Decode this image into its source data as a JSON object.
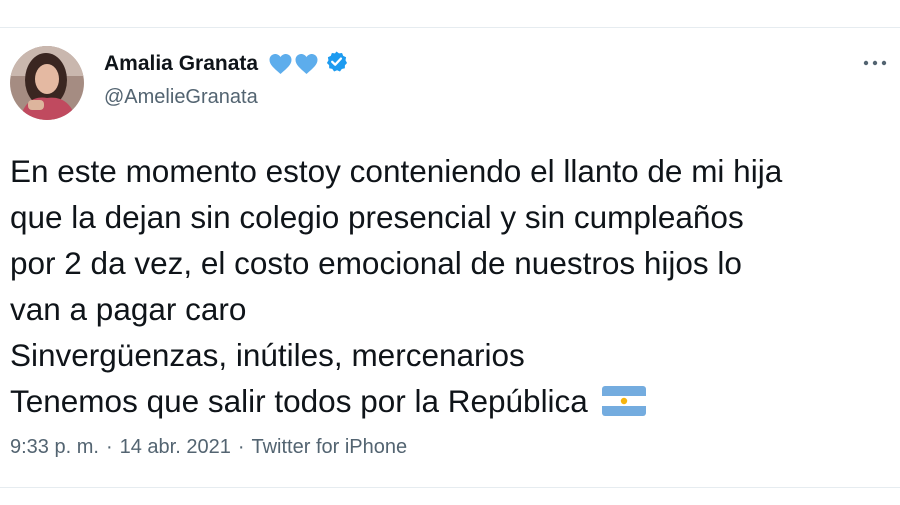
{
  "author": {
    "name": "Amalia Granata",
    "handle": "@AmelieGranata",
    "name_emojis": [
      "blue-heart",
      "blue-heart"
    ],
    "verified": true
  },
  "tweet": {
    "lines": [
      "En este momento estoy conteniendo el llanto de mi hija",
      "que la dejan sin colegio presencial  y sin cumpleaños",
      "por 2 da vez, el costo emocional de nuestros hijos lo",
      "van a pagar caro",
      "Sinvergüenzas, inútiles, mercenarios",
      "Tenemos que salir todos por la República"
    ],
    "trailing_emoji": "argentina-flag"
  },
  "meta": {
    "time": "9:33 p. m.",
    "separator": "·",
    "date": "14 abr. 2021",
    "source": "Twitter for iPhone"
  },
  "colors": {
    "text": "#0f1419",
    "secondary": "#536471",
    "verified_blue": "#1d9bf0",
    "heart_blue": "#5dadec",
    "divider": "#e6ecf0"
  }
}
